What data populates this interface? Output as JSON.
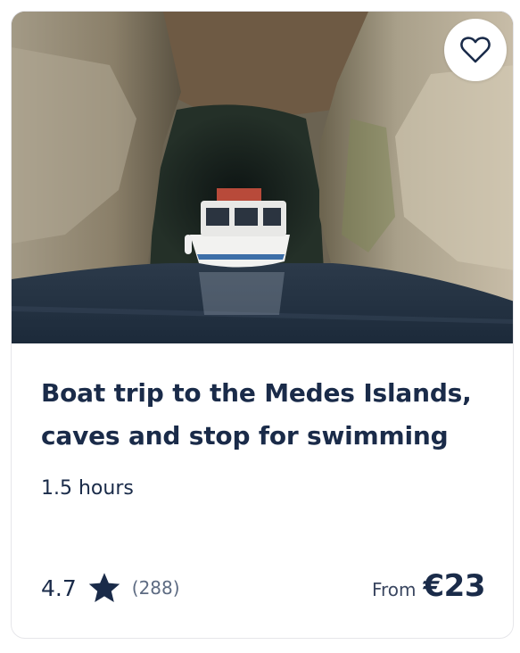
{
  "activity": {
    "title": "Boat trip to the Medes Islands, caves and stop for swimming",
    "duration": "1.5 hours",
    "rating": "4.7",
    "review_count": "(288)",
    "price_prefix": "From",
    "price": "€23"
  },
  "icons": {
    "wishlist": "heart-outline-icon",
    "rating": "star-icon"
  },
  "colors": {
    "text_primary": "#1a2b49",
    "text_secondary": "#5d6b82",
    "card_border": "#e6e6ea"
  }
}
